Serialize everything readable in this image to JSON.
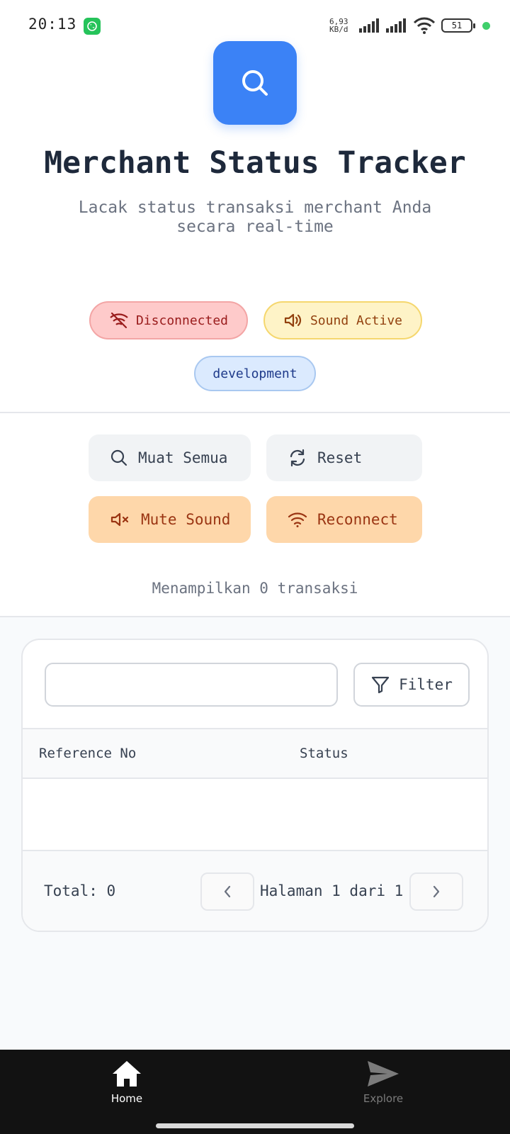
{
  "status_bar": {
    "time": "20:13",
    "network_speed_value": "6,93",
    "network_speed_unit": "KB/d",
    "battery": "51"
  },
  "header": {
    "title": "Merchant Status Tracker",
    "subtitle": "Lacak status transaksi merchant Anda secara real-time"
  },
  "badges": {
    "connection": "Disconnected",
    "sound": "Sound Active",
    "environment": "development"
  },
  "actions": {
    "load_all": "Muat Semua",
    "reset": "Reset",
    "mute_sound": "Mute Sound",
    "reconnect": "Reconnect"
  },
  "summary": {
    "count_text": "Menampilkan 0 transaksi"
  },
  "table": {
    "search_value": "",
    "filter_label": "Filter",
    "columns": [
      "Reference No",
      "Status"
    ],
    "rows": [],
    "total_text": "Total: 0",
    "page_text": "Halaman 1 dari 1"
  },
  "bottom_nav": {
    "items": [
      {
        "label": "Home",
        "icon": "home-icon",
        "active": true
      },
      {
        "label": "Explore",
        "icon": "send-icon",
        "active": false
      }
    ]
  },
  "colors": {
    "primary": "#3b82f6",
    "disconnected_bg": "#fecaca",
    "sound_bg": "#fef3c7",
    "env_bg": "#dbeafe",
    "orange_btn": "#fed7aa"
  }
}
